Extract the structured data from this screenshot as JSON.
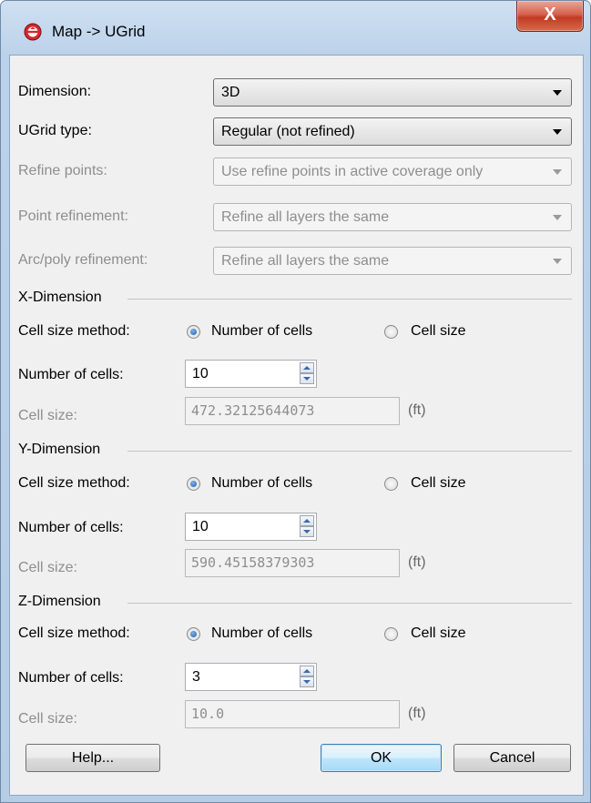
{
  "window": {
    "title": "Map -> UGrid",
    "close_glyph": "X",
    "app_icon": "app-logo-icon"
  },
  "general": {
    "dimension_label": "Dimension:",
    "dimension_value": "3D",
    "ugrid_type_label": "UGrid type:",
    "ugrid_type_value": "Regular (not refined)",
    "refine_points_label": "Refine points:",
    "refine_points_value": "Use refine points in active coverage only",
    "point_refinement_label": "Point refinement:",
    "point_refinement_value": "Refine all layers the same",
    "arc_poly_refinement_label": "Arc/poly refinement:",
    "arc_poly_refinement_value": "Refine all layers the same"
  },
  "x": {
    "group_title": "X-Dimension",
    "method_label": "Cell size method:",
    "option_number": "Number of cells",
    "option_size": "Cell size",
    "selected": "number_of_cells",
    "num_cells_label": "Number of cells:",
    "num_cells_value": "10",
    "cell_size_label": "Cell size:",
    "cell_size_value": "472.32125644073",
    "unit": "(ft)"
  },
  "y": {
    "group_title": "Y-Dimension",
    "method_label": "Cell size method:",
    "option_number": "Number of cells",
    "option_size": "Cell size",
    "selected": "number_of_cells",
    "num_cells_label": "Number of cells:",
    "num_cells_value": "10",
    "cell_size_label": "Cell size:",
    "cell_size_value": "590.45158379303",
    "unit": "(ft)"
  },
  "z": {
    "group_title": "Z-Dimension",
    "method_label": "Cell size method:",
    "option_number": "Number of cells",
    "option_size": "Cell size",
    "selected": "number_of_cells",
    "num_cells_label": "Number of cells:",
    "num_cells_value": "3",
    "cell_size_label": "Cell size:",
    "cell_size_value": "10.0",
    "unit": "(ft)"
  },
  "buttons": {
    "help": "Help...",
    "ok": "OK",
    "cancel": "Cancel"
  }
}
